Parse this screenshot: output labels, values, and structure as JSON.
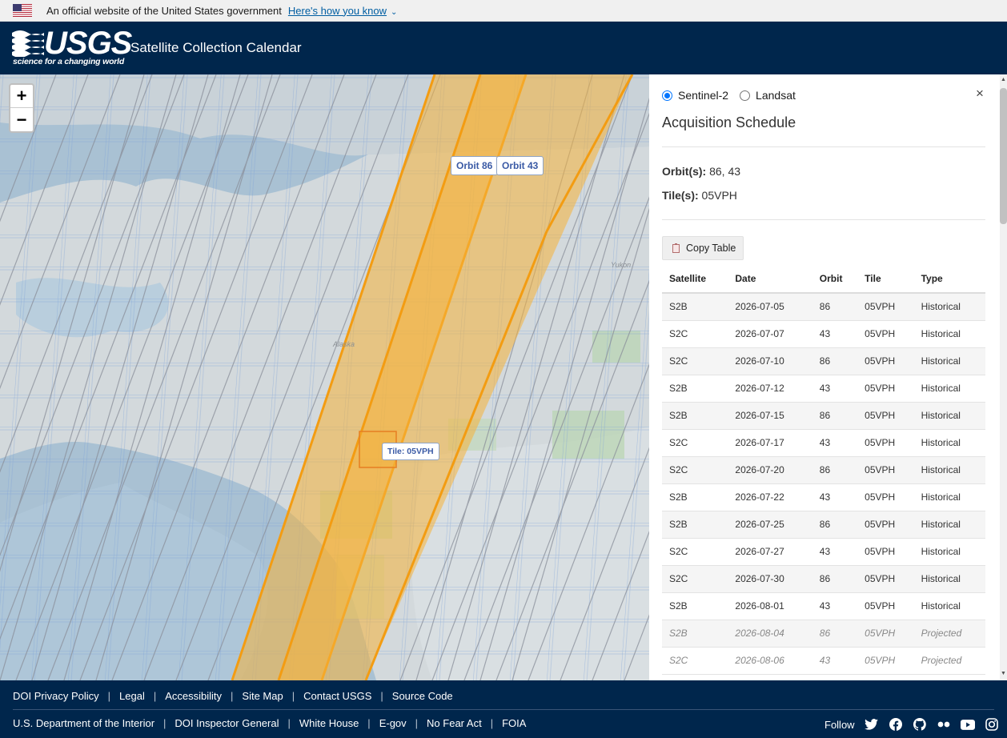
{
  "gov_banner": {
    "text": "An official website of the United States government",
    "link": "Here's how you know"
  },
  "header": {
    "logo_text": "USGS",
    "logo_tagline": "science for a changing world",
    "title": "Satellite Collection Calendar"
  },
  "map": {
    "zoom_in": "+",
    "zoom_out": "−",
    "orbit_labels": [
      "Orbit 86",
      "Orbit 43"
    ],
    "tile_label": "Tile: 05VPH",
    "places": [
      "Alaska",
      "Yukon"
    ]
  },
  "panel": {
    "radio_options": [
      "Sentinel-2",
      "Landsat"
    ],
    "selected": "Sentinel-2",
    "close": "×",
    "title": "Acquisition Schedule",
    "orbits_label": "Orbit(s):",
    "orbits_value": "86, 43",
    "tiles_label": "Tile(s):",
    "tiles_value": "05VPH",
    "copy_button": "Copy Table",
    "columns": [
      "Satellite",
      "Date",
      "Orbit",
      "Tile",
      "Type"
    ],
    "rows": [
      [
        "S2B",
        "2026-07-05",
        "86",
        "05VPH",
        "Historical"
      ],
      [
        "S2C",
        "2026-07-07",
        "43",
        "05VPH",
        "Historical"
      ],
      [
        "S2C",
        "2026-07-10",
        "86",
        "05VPH",
        "Historical"
      ],
      [
        "S2B",
        "2026-07-12",
        "43",
        "05VPH",
        "Historical"
      ],
      [
        "S2B",
        "2026-07-15",
        "86",
        "05VPH",
        "Historical"
      ],
      [
        "S2C",
        "2026-07-17",
        "43",
        "05VPH",
        "Historical"
      ],
      [
        "S2C",
        "2026-07-20",
        "86",
        "05VPH",
        "Historical"
      ],
      [
        "S2B",
        "2026-07-22",
        "43",
        "05VPH",
        "Historical"
      ],
      [
        "S2B",
        "2026-07-25",
        "86",
        "05VPH",
        "Historical"
      ],
      [
        "S2C",
        "2026-07-27",
        "43",
        "05VPH",
        "Historical"
      ],
      [
        "S2C",
        "2026-07-30",
        "86",
        "05VPH",
        "Historical"
      ],
      [
        "S2B",
        "2026-08-01",
        "43",
        "05VPH",
        "Historical"
      ],
      [
        "S2B",
        "2026-08-04",
        "86",
        "05VPH",
        "Projected"
      ],
      [
        "S2C",
        "2026-08-06",
        "43",
        "05VPH",
        "Projected"
      ]
    ]
  },
  "footer": {
    "row1": [
      "DOI Privacy Policy",
      "Legal",
      "Accessibility",
      "Site Map",
      "Contact USGS",
      "Source Code"
    ],
    "row2": [
      "U.S. Department of the Interior",
      "DOI Inspector General",
      "White House",
      "E-gov",
      "No Fear Act",
      "FOIA"
    ],
    "follow_label": "Follow",
    "social_icons": [
      "twitter-icon",
      "facebook-icon",
      "github-icon",
      "flickr-icon",
      "youtube-icon",
      "instagram-icon"
    ]
  },
  "colors": {
    "header_bg": "#00264c",
    "swath_fill": "#f5b23a",
    "swath_stroke": "#f39c12",
    "link_blue": "#005ea2",
    "radio_blue": "#0075ff"
  }
}
